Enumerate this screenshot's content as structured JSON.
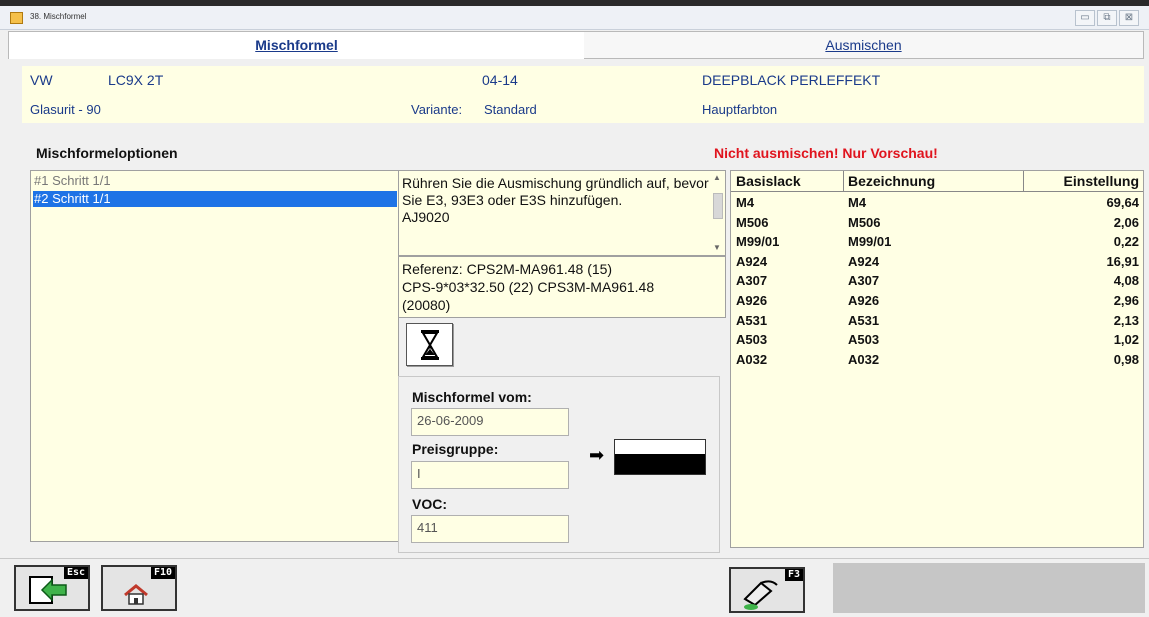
{
  "window": {
    "title": "38. Mischformel",
    "controls": [
      "minimize",
      "restore",
      "close"
    ]
  },
  "tabs": [
    {
      "label": "Mischformel",
      "active": true
    },
    {
      "label": "Ausmischen",
      "active": false
    }
  ],
  "header": {
    "brand": "VW",
    "code": "LC9X 2T",
    "year": "04-14",
    "color_name": "DEEPBLACK PERLEFFEKT",
    "system": "Glasurit - 90",
    "variant_label": "Variante:",
    "variant_value": "Standard",
    "tone": "Hauptfarbton"
  },
  "options": {
    "title": "Mischformeloptionen",
    "warning": "Nicht ausmischen! Nur Vorschau!",
    "steps": [
      "#1 Schritt 1/1",
      "#2 Schritt 1/1"
    ],
    "selected_index": 1
  },
  "note": {
    "text": "Rühren Sie die Ausmischung gründlich auf, bevor Sie E3, 93E3 oder E3S hinzufügen.",
    "code": "AJ9020"
  },
  "reference": {
    "line1": "Referenz: CPS2M-MA961.48 (15)",
    "line2": "CPS-9*03*32.50 (22)  CPS3M-MA961.48",
    "line3": "(20080)"
  },
  "info": {
    "date_label": "Mischformel vom:",
    "date_value": "26-06-2009",
    "price_label": "Preisgruppe:",
    "price_value": "I",
    "voc_label": "VOC:",
    "voc_value": "411"
  },
  "table": {
    "headers": [
      "Basislack",
      "Bezeichnung",
      "Einstellung"
    ],
    "rows": [
      [
        "M4",
        "M4",
        "69,64"
      ],
      [
        "M506",
        "M506",
        "2,06"
      ],
      [
        "M99/01",
        "M99/01",
        "0,22"
      ],
      [
        "A924",
        "A924",
        "16,91"
      ],
      [
        "A307",
        "A307",
        "4,08"
      ],
      [
        "A926",
        "A926",
        "2,96"
      ],
      [
        "A531",
        "A531",
        "2,13"
      ],
      [
        "A503",
        "A503",
        "1,02"
      ],
      [
        "A032",
        "A032",
        "0,98"
      ]
    ]
  },
  "fkeys": [
    {
      "key": "Esc",
      "icon": "exit-arrow-icon"
    },
    {
      "key": "F10",
      "icon": "home-icon"
    },
    {
      "key": "F3",
      "icon": "paint-pour-icon"
    }
  ],
  "colors": {
    "accent_blue": "#1a3a8a",
    "selection": "#1e73e6",
    "warning_red": "#e0141e",
    "panel_yellow": "#ffffe4"
  }
}
